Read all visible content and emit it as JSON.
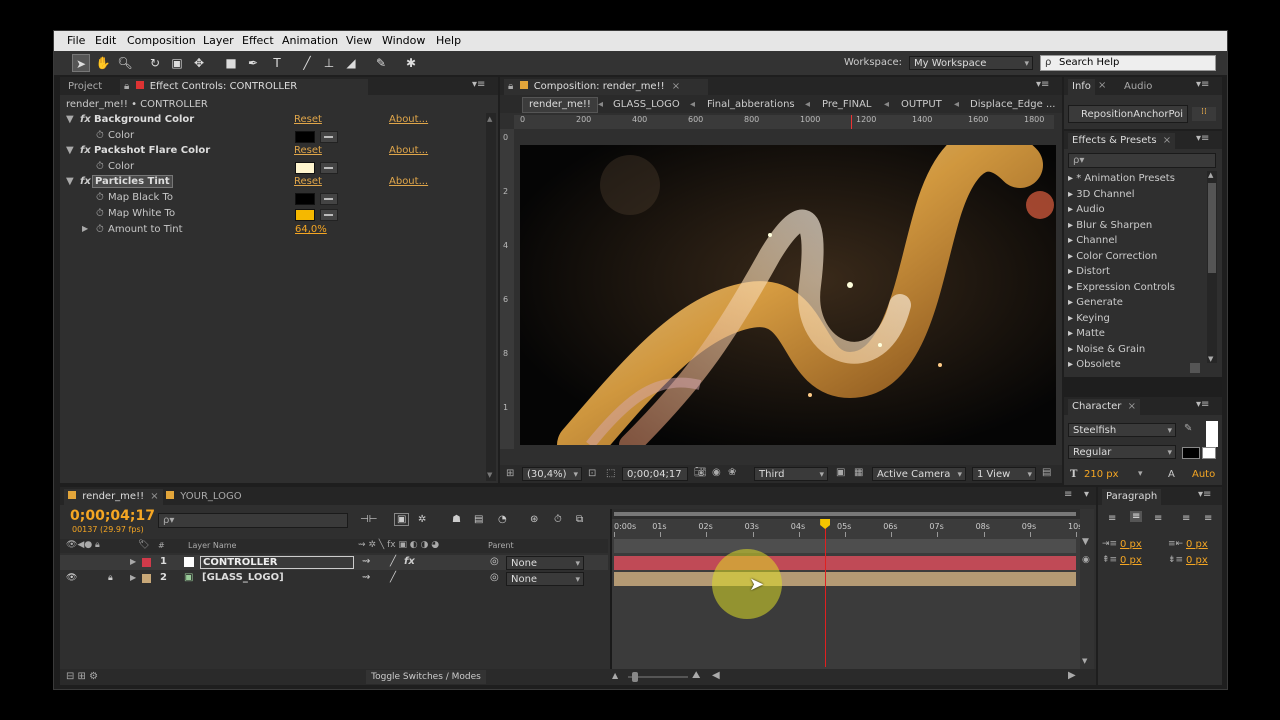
{
  "menu": [
    "File",
    "Edit",
    "Composition",
    "Layer",
    "Effect",
    "Animation",
    "View",
    "Window",
    "Help"
  ],
  "toolbar": {
    "workspace_label": "Workspace:",
    "workspace_value": "My Workspace",
    "search_help": "Search Help"
  },
  "effect_controls": {
    "project_tab": "Project",
    "tab": "Effect Controls: CONTROLLER",
    "breadcrumb": "render_me!! • CONTROLLER",
    "effects": [
      {
        "name": "Background Color",
        "reset": "Reset",
        "about": "About...",
        "props": [
          {
            "label": "Color",
            "color": "#000000"
          }
        ]
      },
      {
        "name": "Packshot Flare Color",
        "reset": "Reset",
        "about": "About...",
        "props": [
          {
            "label": "Color",
            "color": "#fff6cf"
          }
        ]
      },
      {
        "name": "Particles Tint",
        "reset": "Reset",
        "about": "About...",
        "props": [
          {
            "label": "Map Black To",
            "color": "#000000"
          },
          {
            "label": "Map White To",
            "color": "#f5b800"
          },
          {
            "label": "Amount to Tint",
            "value": "64,0%"
          }
        ]
      }
    ]
  },
  "composition": {
    "tab": "Composition: render_me!!",
    "nav": [
      "render_me!!",
      "GLASS_LOGO",
      "Final_abberations",
      "Pre_FINAL",
      "OUTPUT",
      "Displace_Edge ..."
    ],
    "ruler_h": [
      "0",
      "200",
      "400",
      "600",
      "800",
      "1000",
      "1200",
      "1400",
      "1600",
      "1800"
    ],
    "ruler_v": [
      "0",
      "2",
      "4",
      "6",
      "8",
      "1"
    ],
    "zoom": "(30,4%)",
    "timecode": "0;00;04;17",
    "resolution": "Third",
    "camera": "Active Camera",
    "views": "1 View"
  },
  "info_panel": {
    "tabs": [
      "Info",
      "Audio"
    ],
    "script": "RepositionAnchorPoi"
  },
  "effects_presets": {
    "tab": "Effects & Presets",
    "search_placeholder": "ρ▾",
    "items": [
      "* Animation Presets",
      "3D Channel",
      "Audio",
      "Blur & Sharpen",
      "Channel",
      "Color Correction",
      "Distort",
      "Expression Controls",
      "Generate",
      "Keying",
      "Matte",
      "Noise & Grain",
      "Obsolete"
    ]
  },
  "character": {
    "tab": "Character",
    "font": "Steelfish",
    "style": "Regular",
    "size": "210 px",
    "leading": "Auto"
  },
  "paragraph": {
    "tab": "Paragraph",
    "indent1": "0 px",
    "indent2": "0 px",
    "indent3": "0 px",
    "indent4": "0 px"
  },
  "timeline": {
    "tabs": [
      "render_me!!",
      "YOUR_LOGO"
    ],
    "timecode": "0;00;04;17",
    "frame_info": "00137 (29.97 fps)",
    "search_placeholder": "ρ▾",
    "col_layer_name": "Layer Name",
    "col_parent": "Parent",
    "col_hash": "#",
    "layers": [
      {
        "num": "1",
        "name": "CONTROLLER",
        "parent": "None",
        "color": "#d03a4a"
      },
      {
        "num": "2",
        "name": "[GLASS_LOGO]",
        "parent": "None",
        "color": "#c8a878"
      }
    ],
    "ruler": [
      "0:00s",
      "01s",
      "02s",
      "03s",
      "04s",
      "05s",
      "06s",
      "07s",
      "08s",
      "09s",
      "10s"
    ],
    "toggle": "Toggle Switches / Modes",
    "playhead_time": 4.57,
    "duration": 10
  }
}
